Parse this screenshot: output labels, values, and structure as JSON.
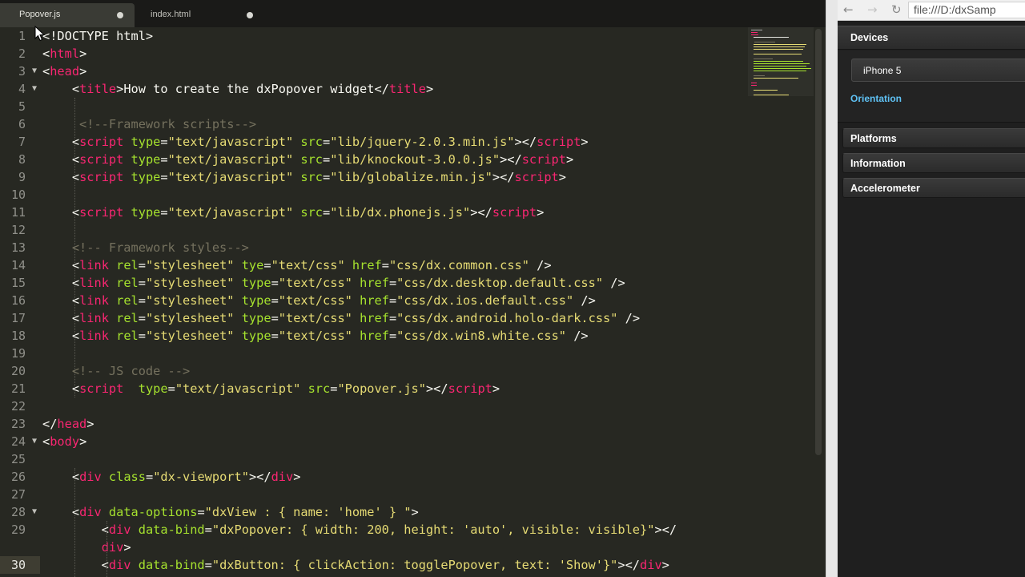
{
  "tabs": [
    {
      "label": "Popover.js",
      "modified": true,
      "active": true
    },
    {
      "label": "index.html",
      "modified": true,
      "active": false
    }
  ],
  "editor": {
    "active_line": 30,
    "lines": [
      {
        "num": "1",
        "fold": false,
        "segments": [
          {
            "t": "<!DOCTYPE html>",
            "c": "tx"
          }
        ]
      },
      {
        "num": "2",
        "fold": false,
        "segments": [
          {
            "t": "<",
            "c": "tx"
          },
          {
            "t": "html",
            "c": "tg"
          },
          {
            "t": ">",
            "c": "tx"
          }
        ]
      },
      {
        "num": "3",
        "fold": true,
        "segments": [
          {
            "t": "<",
            "c": "tx"
          },
          {
            "t": "head",
            "c": "tg"
          },
          {
            "t": ">",
            "c": "tx"
          }
        ]
      },
      {
        "num": "4",
        "fold": true,
        "segments": [
          {
            "t": "    <",
            "c": "tx"
          },
          {
            "t": "title",
            "c": "tg"
          },
          {
            "t": ">How to create the dxPopover widget</",
            "c": "tx"
          },
          {
            "t": "title",
            "c": "tg"
          },
          {
            "t": ">",
            "c": "tx"
          }
        ]
      },
      {
        "num": "5",
        "fold": false,
        "segments": []
      },
      {
        "num": "6",
        "fold": false,
        "segments": [
          {
            "t": "     <!--Framework scripts-->",
            "c": "cm"
          }
        ]
      },
      {
        "num": "7",
        "fold": false,
        "segments": [
          {
            "t": "    <",
            "c": "tx"
          },
          {
            "t": "script",
            "c": "tg"
          },
          {
            "t": " ",
            "c": "tx"
          },
          {
            "t": "type",
            "c": "at"
          },
          {
            "t": "=",
            "c": "tx"
          },
          {
            "t": "\"text/javascript\"",
            "c": "st"
          },
          {
            "t": " ",
            "c": "tx"
          },
          {
            "t": "src",
            "c": "at"
          },
          {
            "t": "=",
            "c": "tx"
          },
          {
            "t": "\"lib/jquery-2.0.3.min.js\"",
            "c": "st"
          },
          {
            "t": "></",
            "c": "tx"
          },
          {
            "t": "script",
            "c": "tg"
          },
          {
            "t": ">",
            "c": "tx"
          }
        ]
      },
      {
        "num": "8",
        "fold": false,
        "segments": [
          {
            "t": "    <",
            "c": "tx"
          },
          {
            "t": "script",
            "c": "tg"
          },
          {
            "t": " ",
            "c": "tx"
          },
          {
            "t": "type",
            "c": "at"
          },
          {
            "t": "=",
            "c": "tx"
          },
          {
            "t": "\"text/javascript\"",
            "c": "st"
          },
          {
            "t": " ",
            "c": "tx"
          },
          {
            "t": "src",
            "c": "at"
          },
          {
            "t": "=",
            "c": "tx"
          },
          {
            "t": "\"lib/knockout-3.0.0.js\"",
            "c": "st"
          },
          {
            "t": "></",
            "c": "tx"
          },
          {
            "t": "script",
            "c": "tg"
          },
          {
            "t": ">",
            "c": "tx"
          }
        ]
      },
      {
        "num": "9",
        "fold": false,
        "segments": [
          {
            "t": "    <",
            "c": "tx"
          },
          {
            "t": "script",
            "c": "tg"
          },
          {
            "t": " ",
            "c": "tx"
          },
          {
            "t": "type",
            "c": "at"
          },
          {
            "t": "=",
            "c": "tx"
          },
          {
            "t": "\"text/javascript\"",
            "c": "st"
          },
          {
            "t": " ",
            "c": "tx"
          },
          {
            "t": "src",
            "c": "at"
          },
          {
            "t": "=",
            "c": "tx"
          },
          {
            "t": "\"lib/globalize.min.js\"",
            "c": "st"
          },
          {
            "t": "></",
            "c": "tx"
          },
          {
            "t": "script",
            "c": "tg"
          },
          {
            "t": ">",
            "c": "tx"
          }
        ]
      },
      {
        "num": "10",
        "fold": false,
        "segments": []
      },
      {
        "num": "11",
        "fold": false,
        "segments": [
          {
            "t": "    <",
            "c": "tx"
          },
          {
            "t": "script",
            "c": "tg"
          },
          {
            "t": " ",
            "c": "tx"
          },
          {
            "t": "type",
            "c": "at"
          },
          {
            "t": "=",
            "c": "tx"
          },
          {
            "t": "\"text/javascript\"",
            "c": "st"
          },
          {
            "t": " ",
            "c": "tx"
          },
          {
            "t": "src",
            "c": "at"
          },
          {
            "t": "=",
            "c": "tx"
          },
          {
            "t": "\"lib/dx.phonejs.js\"",
            "c": "st"
          },
          {
            "t": "></",
            "c": "tx"
          },
          {
            "t": "script",
            "c": "tg"
          },
          {
            "t": ">",
            "c": "tx"
          }
        ]
      },
      {
        "num": "12",
        "fold": false,
        "segments": []
      },
      {
        "num": "13",
        "fold": false,
        "segments": [
          {
            "t": "    <!-- Framework styles-->",
            "c": "cm"
          }
        ]
      },
      {
        "num": "14",
        "fold": false,
        "segments": [
          {
            "t": "    <",
            "c": "tx"
          },
          {
            "t": "link",
            "c": "tg"
          },
          {
            "t": " ",
            "c": "tx"
          },
          {
            "t": "rel",
            "c": "at"
          },
          {
            "t": "=",
            "c": "tx"
          },
          {
            "t": "\"stylesheet\"",
            "c": "st"
          },
          {
            "t": " ",
            "c": "tx"
          },
          {
            "t": "tye",
            "c": "at"
          },
          {
            "t": "=",
            "c": "tx"
          },
          {
            "t": "\"text/css\"",
            "c": "st"
          },
          {
            "t": " ",
            "c": "tx"
          },
          {
            "t": "href",
            "c": "at"
          },
          {
            "t": "=",
            "c": "tx"
          },
          {
            "t": "\"css/dx.common.css\"",
            "c": "st"
          },
          {
            "t": " />",
            "c": "tx"
          }
        ]
      },
      {
        "num": "15",
        "fold": false,
        "segments": [
          {
            "t": "    <",
            "c": "tx"
          },
          {
            "t": "link",
            "c": "tg"
          },
          {
            "t": " ",
            "c": "tx"
          },
          {
            "t": "rel",
            "c": "at"
          },
          {
            "t": "=",
            "c": "tx"
          },
          {
            "t": "\"stylesheet\"",
            "c": "st"
          },
          {
            "t": " ",
            "c": "tx"
          },
          {
            "t": "type",
            "c": "at"
          },
          {
            "t": "=",
            "c": "tx"
          },
          {
            "t": "\"text/css\"",
            "c": "st"
          },
          {
            "t": " ",
            "c": "tx"
          },
          {
            "t": "href",
            "c": "at"
          },
          {
            "t": "=",
            "c": "tx"
          },
          {
            "t": "\"css/dx.desktop.default.css\"",
            "c": "st"
          },
          {
            "t": " />",
            "c": "tx"
          }
        ]
      },
      {
        "num": "16",
        "fold": false,
        "segments": [
          {
            "t": "    <",
            "c": "tx"
          },
          {
            "t": "link",
            "c": "tg"
          },
          {
            "t": " ",
            "c": "tx"
          },
          {
            "t": "rel",
            "c": "at"
          },
          {
            "t": "=",
            "c": "tx"
          },
          {
            "t": "\"stylesheet\"",
            "c": "st"
          },
          {
            "t": " ",
            "c": "tx"
          },
          {
            "t": "type",
            "c": "at"
          },
          {
            "t": "=",
            "c": "tx"
          },
          {
            "t": "\"text/css\"",
            "c": "st"
          },
          {
            "t": " ",
            "c": "tx"
          },
          {
            "t": "href",
            "c": "at"
          },
          {
            "t": "=",
            "c": "tx"
          },
          {
            "t": "\"css/dx.ios.default.css\"",
            "c": "st"
          },
          {
            "t": " />",
            "c": "tx"
          }
        ]
      },
      {
        "num": "17",
        "fold": false,
        "segments": [
          {
            "t": "    <",
            "c": "tx"
          },
          {
            "t": "link",
            "c": "tg"
          },
          {
            "t": " ",
            "c": "tx"
          },
          {
            "t": "rel",
            "c": "at"
          },
          {
            "t": "=",
            "c": "tx"
          },
          {
            "t": "\"stylesheet\"",
            "c": "st"
          },
          {
            "t": " ",
            "c": "tx"
          },
          {
            "t": "type",
            "c": "at"
          },
          {
            "t": "=",
            "c": "tx"
          },
          {
            "t": "\"text/css\"",
            "c": "st"
          },
          {
            "t": " ",
            "c": "tx"
          },
          {
            "t": "href",
            "c": "at"
          },
          {
            "t": "=",
            "c": "tx"
          },
          {
            "t": "\"css/dx.android.holo-dark.css\"",
            "c": "st"
          },
          {
            "t": " />",
            "c": "tx"
          }
        ]
      },
      {
        "num": "18",
        "fold": false,
        "segments": [
          {
            "t": "    <",
            "c": "tx"
          },
          {
            "t": "link",
            "c": "tg"
          },
          {
            "t": " ",
            "c": "tx"
          },
          {
            "t": "rel",
            "c": "at"
          },
          {
            "t": "=",
            "c": "tx"
          },
          {
            "t": "\"stylesheet\"",
            "c": "st"
          },
          {
            "t": " ",
            "c": "tx"
          },
          {
            "t": "type",
            "c": "at"
          },
          {
            "t": "=",
            "c": "tx"
          },
          {
            "t": "\"text/css\"",
            "c": "st"
          },
          {
            "t": " ",
            "c": "tx"
          },
          {
            "t": "href",
            "c": "at"
          },
          {
            "t": "=",
            "c": "tx"
          },
          {
            "t": "\"css/dx.win8.white.css\"",
            "c": "st"
          },
          {
            "t": " />",
            "c": "tx"
          }
        ]
      },
      {
        "num": "19",
        "fold": false,
        "segments": []
      },
      {
        "num": "20",
        "fold": false,
        "segments": [
          {
            "t": "    <!-- JS code -->",
            "c": "cm"
          }
        ]
      },
      {
        "num": "21",
        "fold": false,
        "segments": [
          {
            "t": "    <",
            "c": "tx"
          },
          {
            "t": "script",
            "c": "tg"
          },
          {
            "t": "  ",
            "c": "tx"
          },
          {
            "t": "type",
            "c": "at"
          },
          {
            "t": "=",
            "c": "tx"
          },
          {
            "t": "\"text/javascript\"",
            "c": "st"
          },
          {
            "t": " ",
            "c": "tx"
          },
          {
            "t": "src",
            "c": "at"
          },
          {
            "t": "=",
            "c": "tx"
          },
          {
            "t": "\"Popover.js\"",
            "c": "st"
          },
          {
            "t": "></",
            "c": "tx"
          },
          {
            "t": "script",
            "c": "tg"
          },
          {
            "t": ">",
            "c": "tx"
          }
        ]
      },
      {
        "num": "22",
        "fold": false,
        "segments": []
      },
      {
        "num": "23",
        "fold": false,
        "segments": [
          {
            "t": "</",
            "c": "tx"
          },
          {
            "t": "head",
            "c": "tg"
          },
          {
            "t": ">",
            "c": "tx"
          }
        ]
      },
      {
        "num": "24",
        "fold": true,
        "segments": [
          {
            "t": "<",
            "c": "tx"
          },
          {
            "t": "body",
            "c": "tg"
          },
          {
            "t": ">",
            "c": "tx"
          }
        ]
      },
      {
        "num": "25",
        "fold": false,
        "segments": []
      },
      {
        "num": "26",
        "fold": false,
        "segments": [
          {
            "t": "    <",
            "c": "tx"
          },
          {
            "t": "div",
            "c": "tg"
          },
          {
            "t": " ",
            "c": "tx"
          },
          {
            "t": "class",
            "c": "at"
          },
          {
            "t": "=",
            "c": "tx"
          },
          {
            "t": "\"dx-viewport\"",
            "c": "st"
          },
          {
            "t": "></",
            "c": "tx"
          },
          {
            "t": "div",
            "c": "tg"
          },
          {
            "t": ">",
            "c": "tx"
          }
        ]
      },
      {
        "num": "27",
        "fold": false,
        "segments": []
      },
      {
        "num": "28",
        "fold": true,
        "segments": [
          {
            "t": "    <",
            "c": "tx"
          },
          {
            "t": "div",
            "c": "tg"
          },
          {
            "t": " ",
            "c": "tx"
          },
          {
            "t": "data-options",
            "c": "at"
          },
          {
            "t": "=",
            "c": "tx"
          },
          {
            "t": "\"dxView : { name: 'home' } \"",
            "c": "st"
          },
          {
            "t": ">",
            "c": "tx"
          }
        ]
      },
      {
        "num": "29",
        "fold": false,
        "segments": [
          {
            "t": "        <",
            "c": "tx"
          },
          {
            "t": "div",
            "c": "tg"
          },
          {
            "t": " ",
            "c": "tx"
          },
          {
            "t": "data-bind",
            "c": "at"
          },
          {
            "t": "=",
            "c": "tx"
          },
          {
            "t": "\"dxPopover: { width: 200, height: 'auto', visible: visible}\"",
            "c": "st"
          },
          {
            "t": "></",
            "c": "tx"
          }
        ]
      },
      {
        "num": "",
        "fold": false,
        "segments": [
          {
            "t": "        ",
            "c": "tx"
          },
          {
            "t": "div",
            "c": "tg"
          },
          {
            "t": ">",
            "c": "tx"
          }
        ]
      },
      {
        "num": "30",
        "fold": false,
        "segments": [
          {
            "t": "        <",
            "c": "tx"
          },
          {
            "t": "div",
            "c": "tg"
          },
          {
            "t": " ",
            "c": "tx"
          },
          {
            "t": "data-bind",
            "c": "at"
          },
          {
            "t": "=",
            "c": "tx"
          },
          {
            "t": "\"dxButton: { clickAction: togglePopover, text: 'Show'}\"",
            "c": "st"
          },
          {
            "t": "></",
            "c": "tx"
          },
          {
            "t": "div",
            "c": "tg"
          },
          {
            "t": ">",
            "c": "tx"
          }
        ]
      }
    ]
  },
  "browser": {
    "back_icon": "←",
    "forward_icon": "→",
    "reload_icon": "↻",
    "address": "file:///D:/dxSamp",
    "app": {
      "devices_header": "Devices",
      "device_item": "iPhone 5",
      "orientation_label": "Orientation",
      "sections": [
        "Platforms",
        "Information",
        "Accelerometer"
      ]
    }
  },
  "colors": {
    "editor_bg": "#272822",
    "tag": "#f92672",
    "attribute": "#a6e22e",
    "string": "#e6db74",
    "comment": "#75715e",
    "accent_link": "#5fc2f5"
  }
}
